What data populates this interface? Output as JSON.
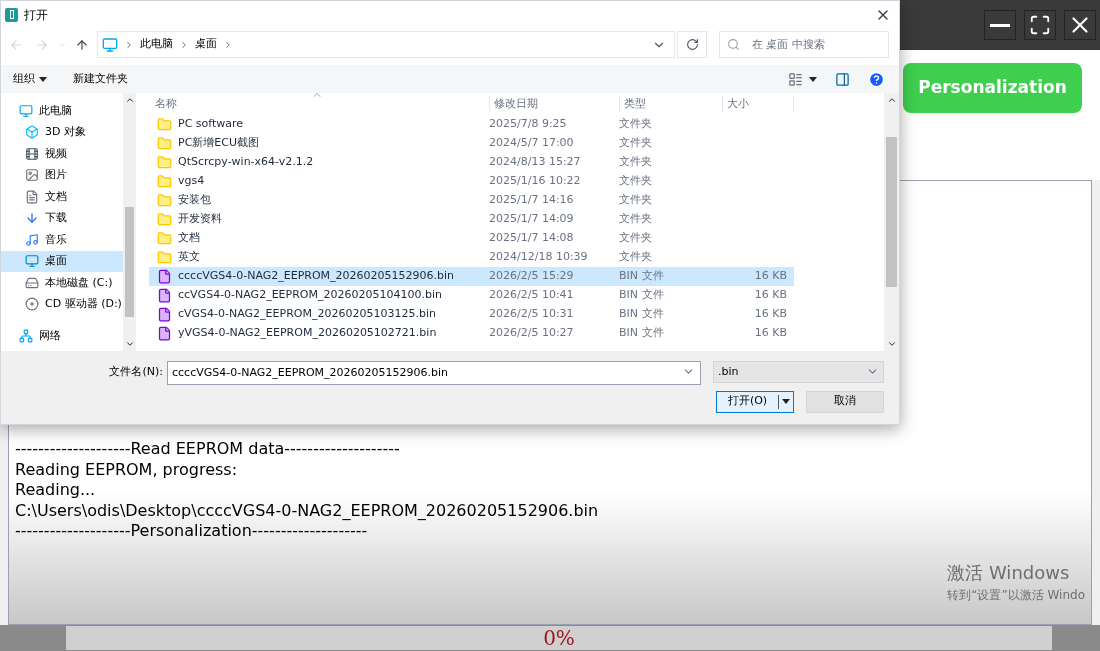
{
  "app": {
    "action_button": "Personalization",
    "log_lines": [
      "--------------------Read EEPROM data--------------------",
      "Reading EEPROM, progress:",
      "Reading...",
      "C:\\Users\\odis\\Desktop\\ccccVGS4-0-NAG2_EEPROM_20260205152906.bin",
      "--------------------Personalization--------------------"
    ],
    "progress": {
      "level": 0,
      "text": "0%"
    },
    "activation_notice": [
      "激活 Windows",
      "转到“设置”以激活 Windo"
    ]
  },
  "dialog": {
    "title": "打开",
    "breadcrumbs": [
      "此电脑",
      "桌面"
    ],
    "search": {
      "placeholder": "在 桌面 中搜索"
    },
    "toolbar": {
      "organize": "组织",
      "new_folder": "新建文件夹"
    },
    "sidebar": {
      "items": [
        {
          "label": "此电脑",
          "kind": "pc",
          "selected": false,
          "children": [
            {
              "label": "3D 对象",
              "kind": "cube",
              "selected": false
            },
            {
              "label": "视频",
              "kind": "video",
              "selected": false
            },
            {
              "label": "图片",
              "kind": "picture",
              "selected": false
            },
            {
              "label": "文档",
              "kind": "document",
              "selected": false
            },
            {
              "label": "下载",
              "kind": "download",
              "selected": false
            },
            {
              "label": "音乐",
              "kind": "music",
              "selected": false
            },
            {
              "label": "桌面",
              "kind": "desktop",
              "selected": true
            },
            {
              "label": "本地磁盘 (C:)",
              "kind": "disk",
              "selected": false
            },
            {
              "label": "CD 驱动器 (D:)",
              "kind": "cd",
              "selected": false
            }
          ]
        },
        {
          "label": "网络",
          "kind": "network",
          "selected": false
        }
      ]
    },
    "table": {
      "columns": [
        "名称",
        "修改日期",
        "类型",
        "大小"
      ],
      "rows": [
        {
          "kind": "folder",
          "name": "PC software",
          "date": "2025/7/8 9:25",
          "type": "文件夹",
          "selected": false
        },
        {
          "kind": "folder",
          "name": "PC新增ECU截图",
          "date": "2024/5/7 17:00",
          "type": "文件夹",
          "selected": false
        },
        {
          "kind": "folder",
          "name": "QtScrcpy-win-x64-v2.1.2",
          "date": "2024/8/13 15:27",
          "type": "文件夹",
          "selected": false
        },
        {
          "kind": "folder",
          "name": "vgs4",
          "date": "2025/1/16 10:22",
          "type": "文件夹",
          "selected": false
        },
        {
          "kind": "folder",
          "name": "安装包",
          "date": "2025/1/7 14:16",
          "type": "文件夹",
          "selected": false
        },
        {
          "kind": "folder",
          "name": "开发资料",
          "date": "2025/1/7 14:09",
          "type": "文件夹",
          "selected": false
        },
        {
          "kind": "folder",
          "name": "文档",
          "date": "2025/1/7 14:08",
          "type": "文件夹",
          "selected": false
        },
        {
          "kind": "folder",
          "name": "英文",
          "date": "2024/12/18 10:39",
          "type": "文件夹",
          "selected": false
        },
        {
          "kind": "file",
          "name": "ccccVGS4-0-NAG2_EEPROM_20260205152906.bin",
          "date": "2026/2/5 15:29",
          "type": "BIN 文件",
          "size": "16 KB",
          "selected": true
        },
        {
          "kind": "file",
          "name": "ccVGS4-0-NAG2_EEPROM_20260205104100.bin",
          "date": "2026/2/5 10:41",
          "type": "BIN 文件",
          "size": "16 KB",
          "selected": false
        },
        {
          "kind": "file",
          "name": "cVGS4-0-NAG2_EEPROM_20260205103125.bin",
          "date": "2026/2/5 10:31",
          "type": "BIN 文件",
          "size": "16 KB",
          "selected": false
        },
        {
          "kind": "file",
          "name": "yVGS4-0-NAG2_EEPROM_20260205102721.bin",
          "date": "2026/2/5 10:27",
          "type": "BIN 文件",
          "size": "16 KB",
          "selected": false
        }
      ]
    },
    "filename_label": "文件名(N):",
    "filename": "ccccVGS4-0-NAG2_EEPROM_20260205152906.bin",
    "filter": ".bin",
    "open_button": "打开(O)",
    "cancel_button": "取消"
  }
}
